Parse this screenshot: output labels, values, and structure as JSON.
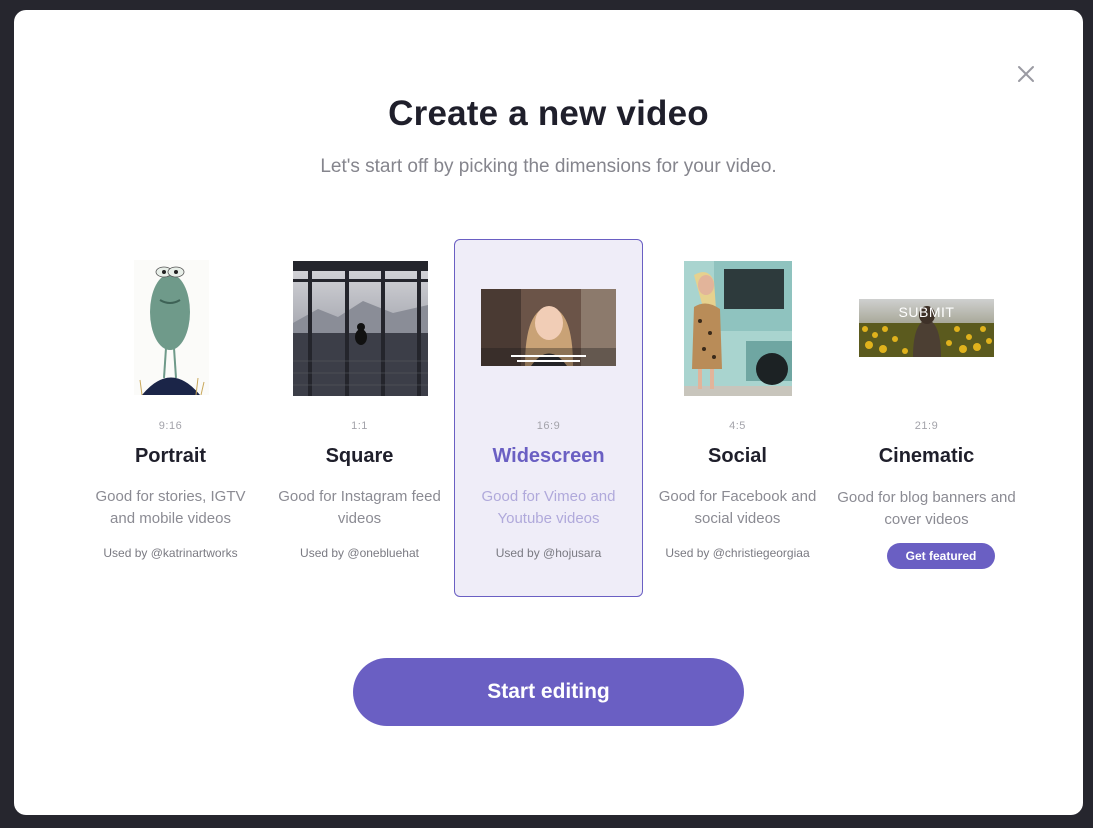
{
  "modal": {
    "title": "Create a new video",
    "subtitle": "Let's start off by picking the dimensions for your video.",
    "close_icon": "close-icon"
  },
  "options": [
    {
      "ratio": "9:16",
      "name": "Portrait",
      "description": "Good for stories, IGTV and mobile videos",
      "used_by": "Used by @katrinartworks",
      "selected": false
    },
    {
      "ratio": "1:1",
      "name": "Square",
      "description": "Good for Instagram feed videos",
      "used_by": "Used by @onebluehat",
      "selected": false
    },
    {
      "ratio": "16:9",
      "name": "Widescreen",
      "description": "Good for Vimeo and Youtube videos",
      "used_by": "Used by @hojusara",
      "selected": true
    },
    {
      "ratio": "4:5",
      "name": "Social",
      "description": "Good for Facebook and social videos",
      "used_by": "Used by @christiegeorgiaa",
      "selected": false
    },
    {
      "ratio": "21:9",
      "name": "Cinematic",
      "description": "Good for blog banners and cover videos",
      "featured_label": "Get featured",
      "thumb_caption": "SUBMIT",
      "selected": false
    }
  ],
  "start_button": "Start editing",
  "colors": {
    "accent": "#6a5fc3",
    "selected_bg": "#efedf8",
    "backdrop": "#26262e"
  }
}
